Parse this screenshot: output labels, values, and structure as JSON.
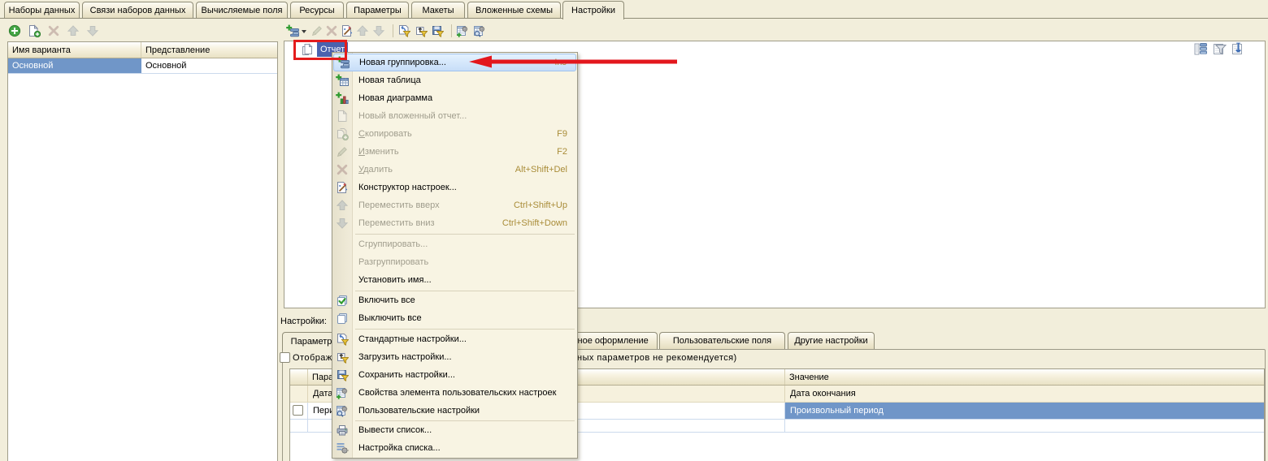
{
  "top_tabs": {
    "items": [
      {
        "label": "Наборы данных",
        "active": false
      },
      {
        "label": "Связи наборов данных",
        "active": false
      },
      {
        "label": "Вычисляемые поля",
        "active": false
      },
      {
        "label": "Ресурсы",
        "active": false
      },
      {
        "label": "Параметры",
        "active": false
      },
      {
        "label": "Макеты",
        "active": false
      },
      {
        "label": "Вложенные схемы",
        "active": false
      },
      {
        "label": "Настройки",
        "active": true
      }
    ]
  },
  "variants_panel": {
    "toolbar": {
      "icons": [
        {
          "name": "add-icon",
          "disabled": false
        },
        {
          "name": "add-copy-icon",
          "disabled": false
        },
        {
          "name": "delete-icon",
          "disabled": true
        },
        {
          "name": "move-up-icon",
          "disabled": true
        },
        {
          "name": "move-down-icon",
          "disabled": true
        }
      ]
    },
    "table": {
      "columns": [
        "Имя варианта",
        "Представление"
      ],
      "rows": [
        {
          "name": "Основной",
          "presentation": "Основной",
          "selected_cell": "name"
        }
      ]
    }
  },
  "structure_panel": {
    "toolbar": {
      "icons": [
        {
          "name": "add-with-menu-icon",
          "disabled": false
        },
        {
          "name": "edit-icon",
          "disabled": true
        },
        {
          "name": "delete-icon",
          "disabled": true
        },
        {
          "name": "settings-constructor-icon",
          "disabled": false
        },
        {
          "name": "move-up-icon",
          "disabled": true
        },
        {
          "name": "move-down-icon",
          "disabled": true
        },
        {
          "name": "standard-settings-icon",
          "disabled": false
        },
        {
          "name": "load-settings-icon",
          "disabled": false
        },
        {
          "name": "save-settings-icon",
          "disabled": false
        },
        {
          "name": "user-settings-item-properties-icon",
          "disabled": false
        },
        {
          "name": "user-settings-icon",
          "disabled": false
        }
      ]
    },
    "tree": {
      "root": {
        "label": "Отчет",
        "icon": "report-icon",
        "selected": true
      }
    },
    "view_icons": [
      {
        "name": "structure-view-icon"
      },
      {
        "name": "filter-view-icon"
      },
      {
        "name": "output-fields-view-icon"
      }
    ]
  },
  "settings_section": {
    "label": "Настройки:",
    "tabs": [
      {
        "label": "Параметры",
        "active": true
      },
      {
        "label": "Условное оформление",
        "active": false
      },
      {
        "label": "Пользовательские поля",
        "active": false
      },
      {
        "label": "Другие настройки",
        "active": false
      }
    ],
    "show_unavailable_checkbox": {
      "checked": false,
      "label": "Отображать недоступные параметры (использование недоступных параметров не рекомендуется)"
    },
    "params_table": {
      "columns": [
        "",
        "Параметр",
        "Значение"
      ],
      "rows": [
        {
          "checkbox": null,
          "param": "Дата окончания",
          "value": "Дата окончания",
          "kind": "auto"
        },
        {
          "checkbox": false,
          "param": "Период",
          "value": "Произвольный период",
          "kind": "normal",
          "value_selected": true
        },
        {
          "checkbox": null,
          "param": "",
          "value": "",
          "kind": "empty"
        }
      ]
    }
  },
  "context_menu": {
    "items": [
      {
        "label": "Новая группировка...",
        "shortcut": "Ins",
        "icon": "new-grouping-icon",
        "highlighted": true,
        "disabled": false
      },
      {
        "label": "Новая таблица",
        "shortcut": "",
        "icon": "new-table-icon",
        "disabled": false
      },
      {
        "label": "Новая диаграмма",
        "shortcut": "",
        "icon": "new-chart-icon",
        "disabled": false
      },
      {
        "label": "Новый вложенный отчет...",
        "shortcut": "",
        "icon": "nested-report-icon",
        "disabled": true
      },
      {
        "label_head": "С",
        "label_tail": "копировать",
        "shortcut": "F9",
        "icon": "copy-icon",
        "disabled": true
      },
      {
        "label_head": "И",
        "label_tail": "зменить",
        "shortcut": "F2",
        "icon": "edit-icon",
        "disabled": true
      },
      {
        "label_head": "У",
        "label_tail": "далить",
        "shortcut": "Alt+Shift+Del",
        "icon": "delete-icon",
        "disabled": true
      },
      {
        "label": "Конструктор настроек...",
        "shortcut": "",
        "icon": "settings-constructor-icon",
        "disabled": false
      },
      {
        "label": "Переместить вверх",
        "shortcut": "Ctrl+Shift+Up",
        "icon": "move-up-icon",
        "disabled": true
      },
      {
        "label": "Переместить вниз",
        "shortcut": "Ctrl+Shift+Down",
        "icon": "move-down-icon",
        "disabled": true
      },
      {
        "label": "Сгруппировать...",
        "shortcut": "",
        "icon": "",
        "disabled": true
      },
      {
        "label": "Разгруппировать",
        "shortcut": "",
        "icon": "",
        "disabled": true
      },
      {
        "label": "Установить имя...",
        "shortcut": "",
        "icon": "",
        "disabled": false
      },
      {
        "label": "Включить все",
        "shortcut": "",
        "icon": "enable-all-icon",
        "disabled": false
      },
      {
        "label": "Выключить все",
        "shortcut": "",
        "icon": "disable-all-icon",
        "disabled": false
      },
      {
        "label": "Стандартные настройки...",
        "shortcut": "",
        "icon": "standard-settings-icon",
        "disabled": false
      },
      {
        "label": "Загрузить настройки...",
        "shortcut": "",
        "icon": "load-settings-icon",
        "disabled": false
      },
      {
        "label": "Сохранить настройки...",
        "shortcut": "",
        "icon": "save-settings-icon",
        "disabled": false
      },
      {
        "label": "Свойства элемента пользовательских настроек",
        "shortcut": "",
        "icon": "user-settings-item-properties-icon",
        "disabled": false
      },
      {
        "label": "Пользовательские настройки",
        "shortcut": "",
        "icon": "user-settings-icon",
        "disabled": false
      },
      {
        "label": "Вывести список...",
        "shortcut": "",
        "icon": "print-list-icon",
        "disabled": false
      },
      {
        "label": "Настройка списка...",
        "shortcut": "",
        "icon": "list-settings-icon",
        "disabled": false
      }
    ]
  },
  "annotations": {
    "highlight_box_color": "#e41c1c",
    "arrow_color": "#e3171d",
    "arrow_target": "Новая группировка..."
  }
}
